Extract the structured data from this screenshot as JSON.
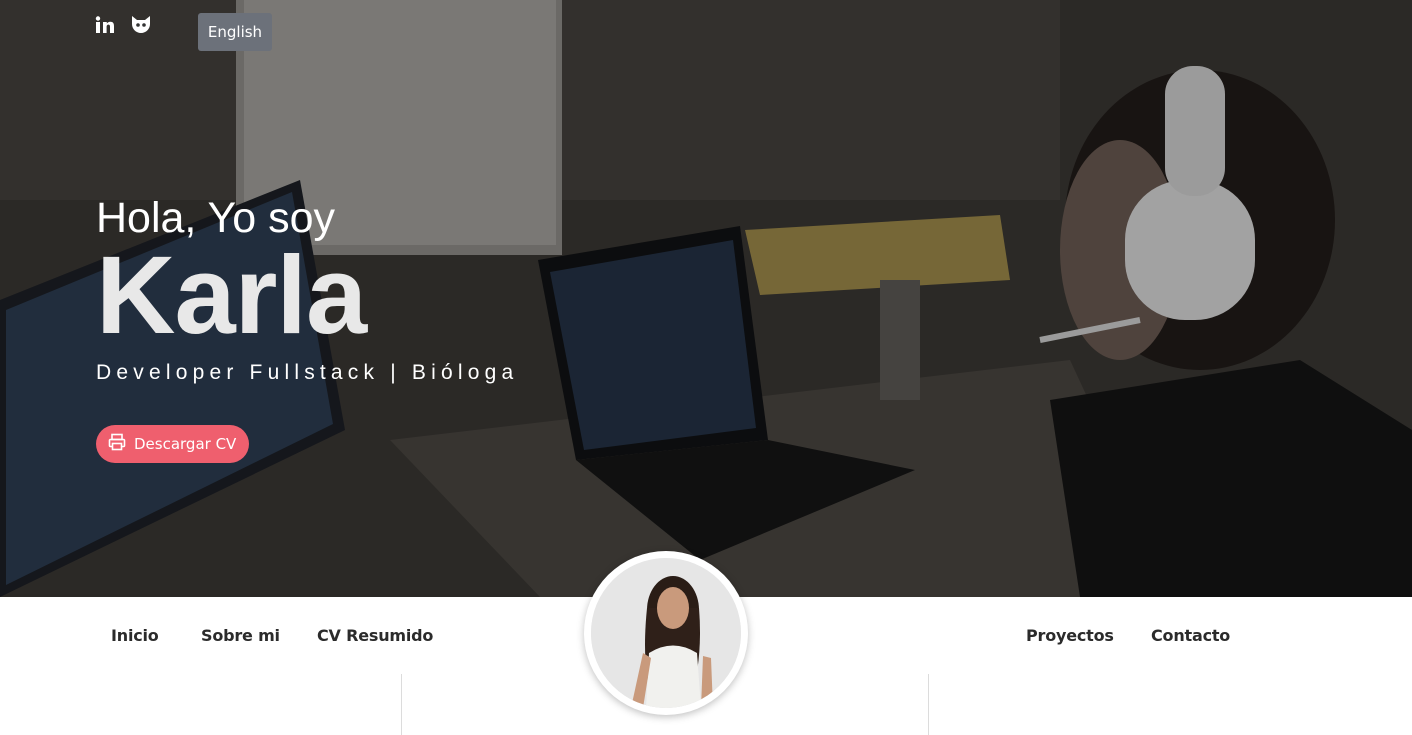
{
  "header": {
    "social": [
      {
        "name": "linkedin-icon",
        "glyph": "in"
      },
      {
        "name": "github-icon",
        "glyph": ""
      }
    ],
    "language_button": "English"
  },
  "hero": {
    "greeting": "Hola, Yo soy",
    "name": "Karla",
    "subtitle": "Developer Fullstack | Bióloga",
    "cv_button": "Descargar CV"
  },
  "nav": {
    "items": [
      "Inicio",
      "Sobre mi",
      "CV Resumido",
      "Proyectos",
      "Contacto"
    ]
  },
  "colors": {
    "accent": "#ef5f6e",
    "lang_button_bg": "#6c717a",
    "nav_text": "#2b2b2b"
  }
}
